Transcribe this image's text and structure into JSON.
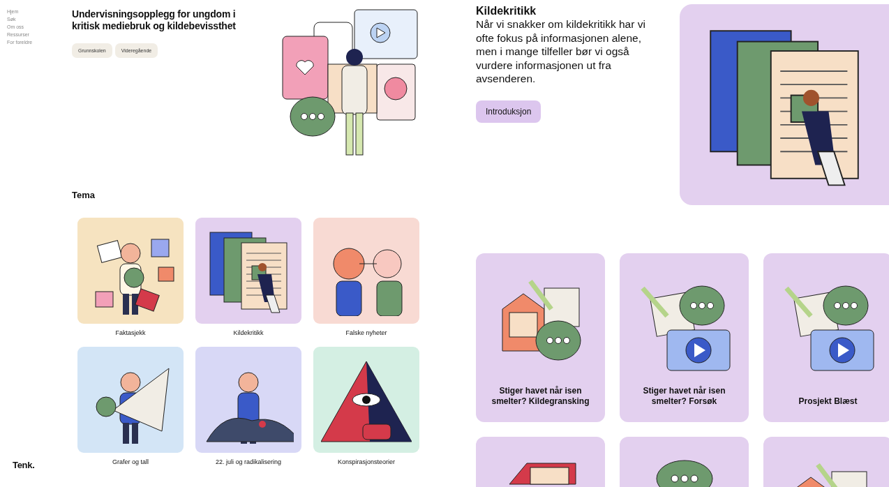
{
  "nav": {
    "items": [
      {
        "label": "Hjem"
      },
      {
        "label": "Søk"
      },
      {
        "label": "Om oss"
      },
      {
        "label": "Ressurser"
      },
      {
        "label": "For foreldre"
      }
    ]
  },
  "logo": "Tenk.",
  "hero": {
    "title": "Undervisningsopplegg for ungdom i kritisk mediebruk og kildebevissthet",
    "tags": [
      "Grunnskolen",
      "Videregående"
    ]
  },
  "themes": {
    "heading": "Tema",
    "items": [
      {
        "label": "Faktasjekk",
        "color": "#f6e3c0"
      },
      {
        "label": "Kildekritikk",
        "color": "#e3d0ef"
      },
      {
        "label": "Falske nyheter",
        "color": "#f8dad3"
      },
      {
        "label": "Grafer og tall",
        "color": "#d3e5f6"
      },
      {
        "label": "22. juli og radikalisering",
        "color": "#d8d8f6"
      },
      {
        "label": "Konspirasjonsteorier",
        "color": "#d4efe3"
      }
    ]
  },
  "detail": {
    "title": "Kildekritikk",
    "text": "Når vi snakker om kildekritikk har vi ofte fokus på informasjonen alene, men i mange tilfeller bør vi også vurdere informasjonen ut fra avsenderen.",
    "button": "Introduksjon"
  },
  "resources": [
    {
      "kind": "document",
      "title": "Stiger havet når isen smelter? Kildegransking"
    },
    {
      "kind": "video",
      "title": "Stiger havet når isen smelter? Forsøk"
    },
    {
      "kind": "video",
      "title": "Prosjekt Blæst"
    },
    {
      "kind": "book"
    },
    {
      "kind": "chat"
    },
    {
      "kind": "document"
    }
  ]
}
